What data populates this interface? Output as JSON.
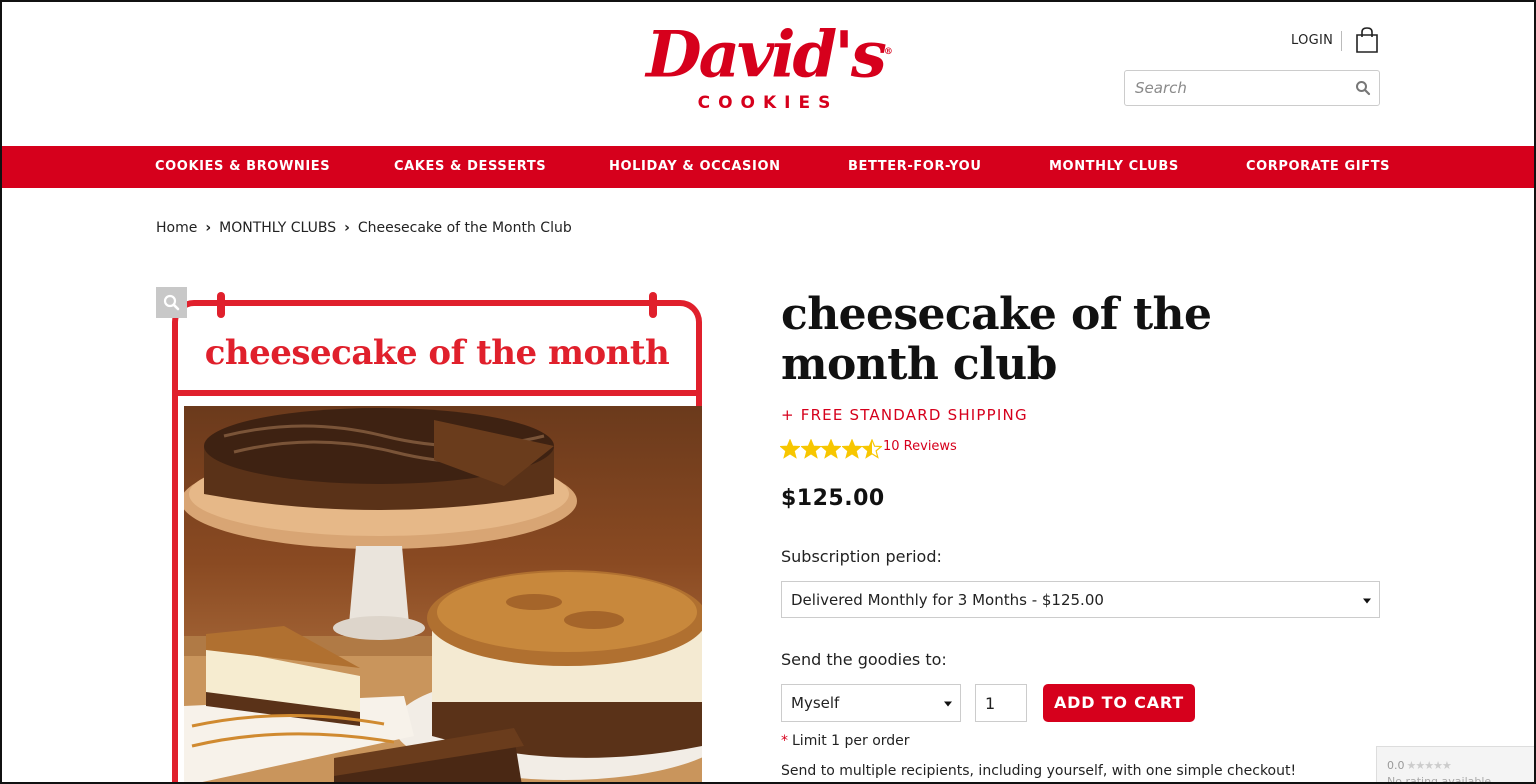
{
  "header": {
    "logo_script": "David's",
    "logo_sub": "COOKIES",
    "logo_reg": "®",
    "login_label": "LOGIN",
    "search_placeholder": "Search"
  },
  "nav": {
    "items": [
      {
        "label": "COOKIES & BROWNIES"
      },
      {
        "label": "CAKES & DESSERTS"
      },
      {
        "label": "HOLIDAY & OCCASION"
      },
      {
        "label": "BETTER-FOR-YOU"
      },
      {
        "label": "MONTHLY CLUBS"
      },
      {
        "label": "CORPORATE GIFTS"
      }
    ]
  },
  "breadcrumb": {
    "items": [
      "Home",
      "MONTHLY CLUBS",
      "Cheesecake of the Month Club"
    ]
  },
  "product": {
    "image_title": "cheesecake of the month",
    "title": "cheesecake of the month club",
    "shipping": "+ FREE STANDARD SHIPPING",
    "rating": 4.5,
    "reviews_label": "10 Reviews",
    "price": "$125.00",
    "subscription_label": "Subscription period:",
    "subscription_value": "Delivered Monthly for 3 Months - $125.00",
    "send_label": "Send the goodies to:",
    "send_value": "Myself",
    "quantity": "1",
    "add_to_cart": "ADD TO CART",
    "limit_asterisk": "*",
    "limit_text": "Limit 1 per order",
    "multi_text": "Send to multiple recipients, including yourself, with one simple checkout!"
  },
  "rating_badge": {
    "score": "0.0",
    "stars": "★★★★★",
    "sub": "No rating available"
  },
  "colors": {
    "brand_red": "#d6001c",
    "star_yellow": "#f7c600"
  },
  "icons": {
    "cart": "shopping-bag-icon",
    "search": "search-icon",
    "zoom": "zoom-icon",
    "caret": "chevron-down-icon"
  }
}
